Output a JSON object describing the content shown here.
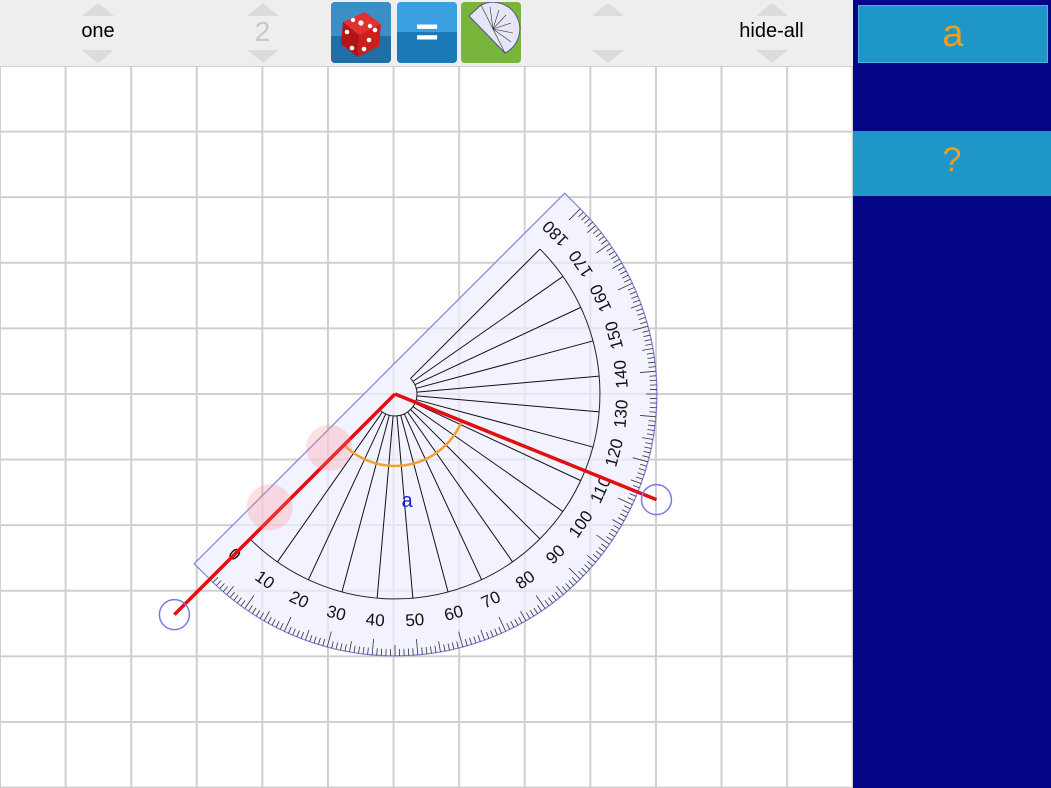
{
  "toolbar": {
    "count_value": "one",
    "step_value": "2",
    "visibility_value": "hide-all",
    "dice_icon": "red-dice-icon",
    "equals_icon": "equals-icon",
    "protractor_icon": "protractor-icon",
    "equals_glyph": "="
  },
  "angle": {
    "label": "a"
  },
  "protractor": {
    "labels": [
      "0",
      "10",
      "20",
      "30",
      "40",
      "50",
      "60",
      "70",
      "80",
      "90",
      "100",
      "110",
      "120",
      "130",
      "140",
      "150",
      "160",
      "170",
      "180"
    ]
  },
  "sidebar": {
    "answer_button": "a",
    "hint_button": "?"
  },
  "colors": {
    "toolbar_bg": "#eeeeee",
    "grid_line": "#cfcfcf",
    "sidebar_bg": "#050687",
    "sidebar_button": "#1e96c8",
    "sidebar_text": "#e9a020",
    "ray": "#e01010",
    "angle_arc": "#f0a030",
    "protractor_fill": "#eeeeff",
    "protractor_edge": "#8080e0"
  }
}
